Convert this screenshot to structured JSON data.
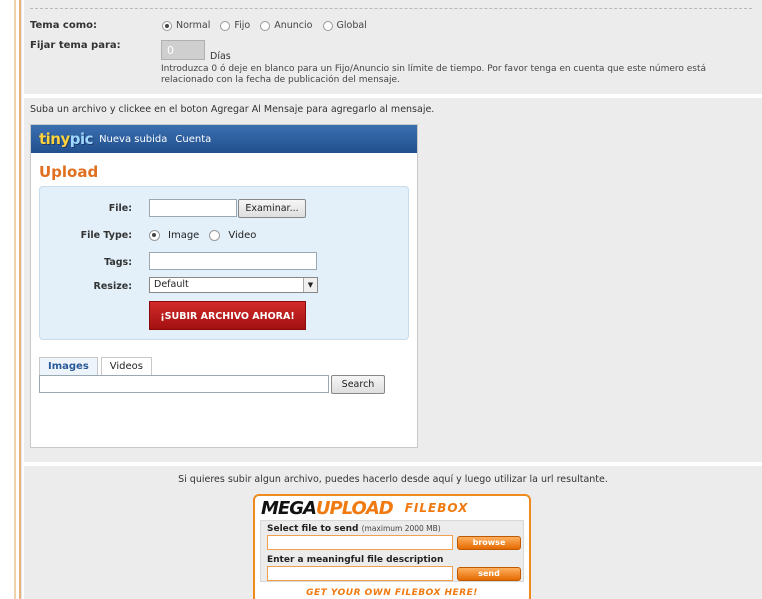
{
  "topic": {
    "tema_label": "Tema como:",
    "options": [
      {
        "label": "Normal",
        "selected": true
      },
      {
        "label": "Fijo",
        "selected": false
      },
      {
        "label": "Anuncio",
        "selected": false
      },
      {
        "label": "Global",
        "selected": false
      }
    ],
    "fijar_label": "Fijar tema para:",
    "days_value": "0",
    "days_unit": "Días",
    "hint": "Introduzca 0 ó deje en blanco para un Fijo/Anuncio sin límite de tiempo. Por favor tenga en cuenta que este número está relacionado con la fecha de publicación del mensaje."
  },
  "upload": {
    "intro": "Suba un archivo y clickee en el boton Agregar Al Mensaje para agregarlo al mensaje.",
    "tinypic": {
      "logo_a": "tiny",
      "logo_b": "pic",
      "nav": [
        "Nueva subida",
        "Cuenta"
      ],
      "title": "Upload",
      "file_label": "File:",
      "browse_label": "Examinar...",
      "filetype_label": "File Type:",
      "filetype_options": [
        {
          "label": "Image",
          "selected": true
        },
        {
          "label": "Video",
          "selected": false
        }
      ],
      "tags_label": "Tags:",
      "resize_label": "Resize:",
      "resize_value": "Default",
      "submit_label": "¡SUBIR ARCHIVO AHORA!",
      "tabs": [
        {
          "label": "Images",
          "active": true
        },
        {
          "label": "Videos",
          "active": false
        }
      ],
      "search_label": "Search"
    }
  },
  "megaupload": {
    "intro": "Si quieres subir algun archivo, puedes hacerlo desde aquí y luego utilizar la url resultante.",
    "logo_a": "MEGA",
    "logo_b": "UPLOAD",
    "logo_c": "FILEBOX",
    "select_label": "Select file to send",
    "select_hint": "(maximum 2000 MB)",
    "browse_label": "browse",
    "desc_label": "Enter a meaningful file description",
    "send_label": "send",
    "footer": "GET YOUR OWN FILEBOX HERE!"
  }
}
